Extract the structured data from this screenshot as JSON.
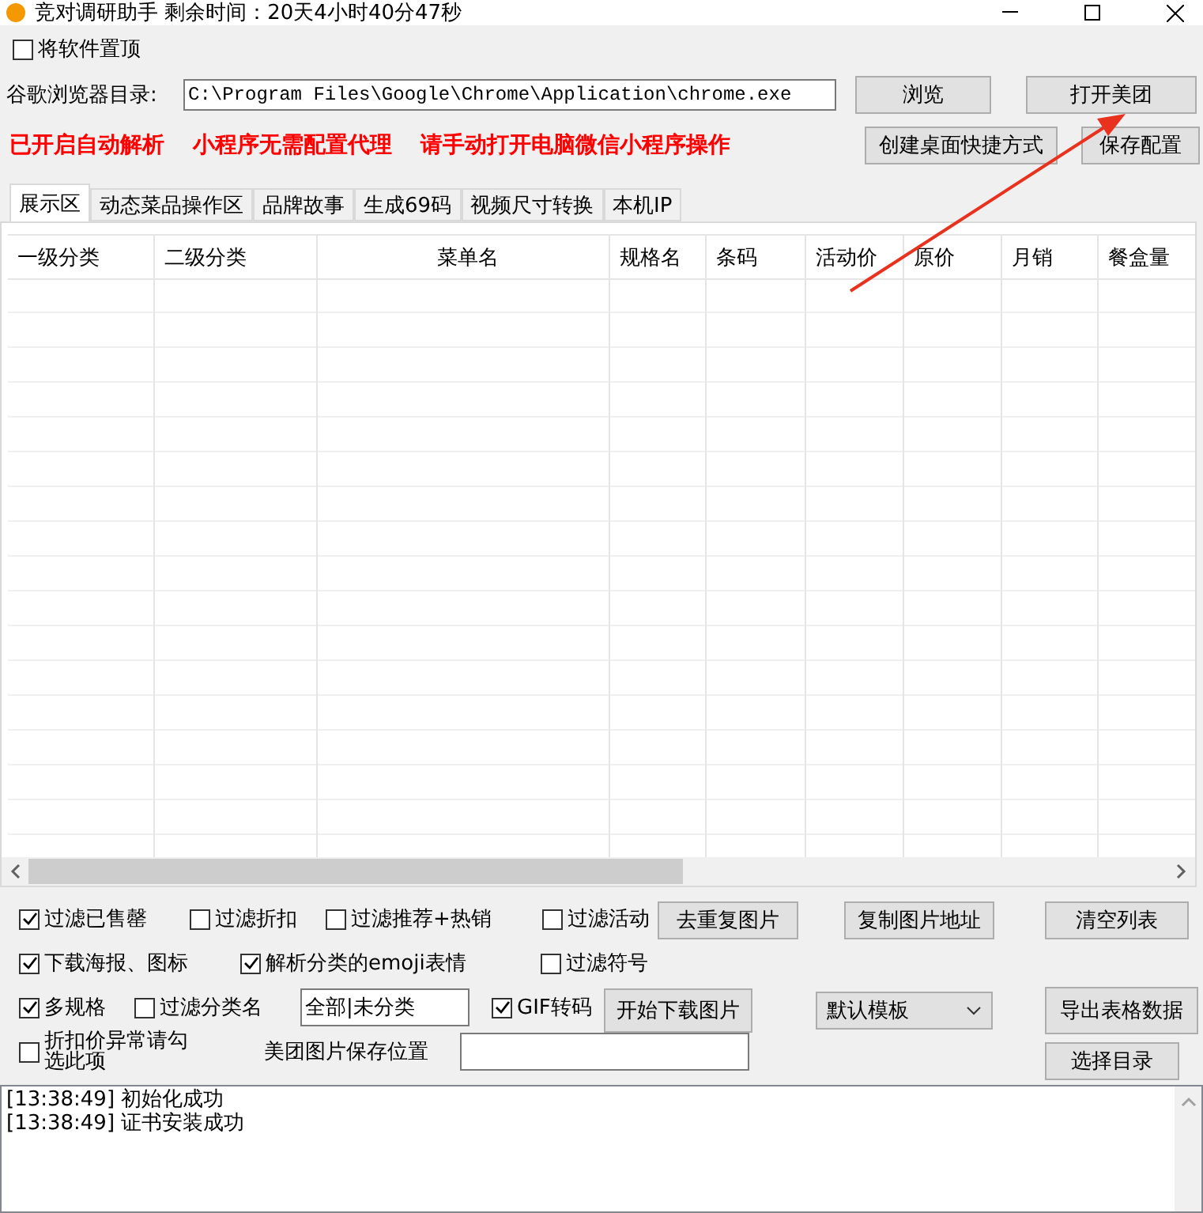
{
  "window": {
    "title": "竞对调研助手  剩余时间：20天4小时40分47秒"
  },
  "pin_on_top": {
    "label": "将软件置顶",
    "checked": false
  },
  "browser_path": {
    "label": "谷歌浏览器目录:",
    "value": "C:\\Program Files\\Google\\Chrome\\Application\\chrome.exe"
  },
  "path_buttons": [
    "浏览",
    "打开美团"
  ],
  "notices": [
    "已开启自动解析",
    "小程序无需配置代理",
    "请手动打开电脑微信小程序操作"
  ],
  "config_buttons": [
    "创建桌面快捷方式",
    "保存配置"
  ],
  "tabs": [
    {
      "label": "展示区",
      "selected": true
    },
    {
      "label": "动态菜品操作区",
      "selected": false
    },
    {
      "label": "品牌故事",
      "selected": false
    },
    {
      "label": "生成69码",
      "selected": false
    },
    {
      "label": "视频尺寸转换",
      "selected": false
    },
    {
      "label": "本机IP",
      "selected": false
    }
  ],
  "table": {
    "columns": [
      "一级分类",
      "二级分类",
      "菜单名",
      "规格名",
      "条码",
      "活动价",
      "原价",
      "月销",
      "餐盒量"
    ]
  },
  "option_rows": [
    [
      {
        "kind": "checkbox",
        "label": "过滤已售罄",
        "checked": true
      },
      {
        "kind": "checkbox",
        "label": "过滤折扣",
        "checked": false
      },
      {
        "kind": "checkbox",
        "label": "过滤推荐+热销",
        "checked": false
      },
      {
        "kind": "checkbox",
        "label": "过滤活动",
        "checked": false
      }
    ],
    [
      {
        "kind": "checkbox",
        "label": "下载海报、图标",
        "checked": true
      },
      {
        "kind": "checkbox",
        "label": "解析分类的emoji表情",
        "checked": true
      },
      {
        "kind": "checkbox",
        "label": "过滤符号",
        "checked": false
      }
    ],
    [
      {
        "kind": "checkbox",
        "label": "多规格",
        "checked": true
      },
      {
        "kind": "checkbox",
        "label": "过滤分类名",
        "checked": false
      },
      {
        "kind": "field",
        "value": "全部|未分类"
      },
      {
        "kind": "checkbox",
        "label": "GIF转码",
        "checked": true
      }
    ],
    [
      {
        "kind": "checkbox",
        "label": "折扣价异常请勾选此项",
        "checked": false
      },
      {
        "kind": "label",
        "label": "美团图片保存位置"
      },
      {
        "kind": "wide_field"
      }
    ]
  ],
  "image_buttons": [
    "去重复图片",
    "复制图片地址",
    "清空列表"
  ],
  "download_button": "开始下载图片",
  "template_select": {
    "value": "默认模板"
  },
  "export_button": "导出表格数据",
  "choose_dir_button": "选择目录",
  "log": [
    "[13:38:49] 初始化成功",
    "[13:38:49] 证书安装成功"
  ]
}
